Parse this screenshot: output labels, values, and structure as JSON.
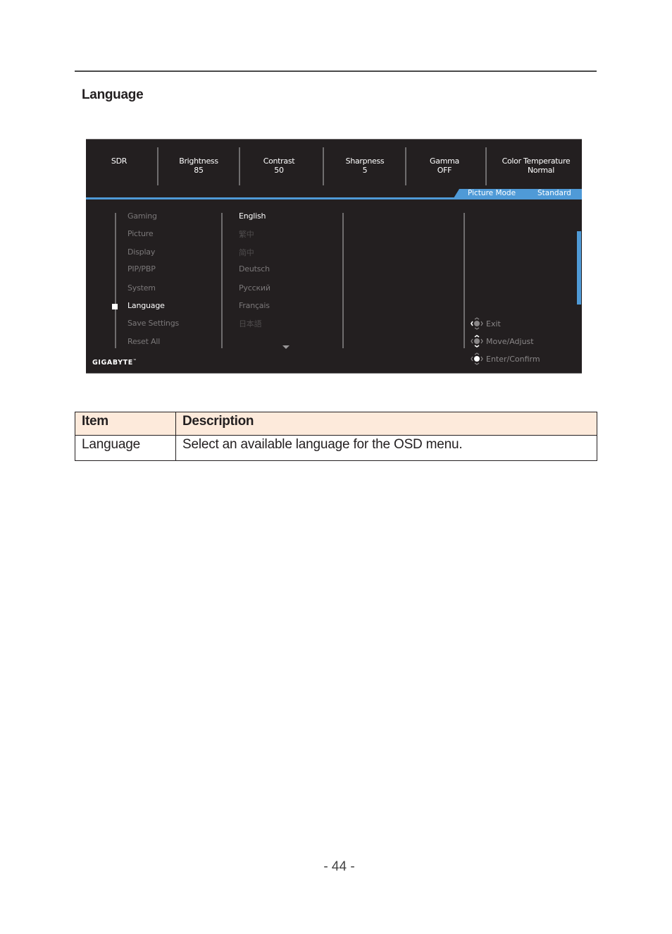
{
  "section": {
    "title": "Language"
  },
  "osd": {
    "stats": [
      {
        "label": "SDR",
        "value": ""
      },
      {
        "label": "Brightness",
        "value": "85"
      },
      {
        "label": "Contrast",
        "value": "50"
      },
      {
        "label": "Sharpness",
        "value": "5"
      },
      {
        "label": "Gamma",
        "value": "OFF"
      },
      {
        "label": "Color Temperature",
        "value": "Normal"
      }
    ],
    "picture_mode": {
      "label": "Picture Mode",
      "value": "Standard"
    },
    "menu": [
      {
        "label": "Gaming",
        "active": false
      },
      {
        "label": "Picture",
        "active": false
      },
      {
        "label": "Display",
        "active": false
      },
      {
        "label": "PIP/PBP",
        "active": false
      },
      {
        "label": "System",
        "active": false
      },
      {
        "label": "Language",
        "active": true
      },
      {
        "label": "Save Settings",
        "active": false
      },
      {
        "label": "Reset All",
        "active": false
      }
    ],
    "languages": [
      {
        "label": "English",
        "state": "selected"
      },
      {
        "label": "繁中",
        "state": "dim"
      },
      {
        "label": "简中",
        "state": "dim"
      },
      {
        "label": "Deutsch",
        "state": "normal"
      },
      {
        "label": "Русский",
        "state": "normal"
      },
      {
        "label": "Français",
        "state": "normal"
      },
      {
        "label": "日本語",
        "state": "dim"
      }
    ],
    "hints": [
      {
        "icon": "joystick-left-icon",
        "label": "Exit"
      },
      {
        "icon": "joystick-updown-icon",
        "label": "Move/Adjust"
      },
      {
        "icon": "joystick-press-icon",
        "label": "Enter/Confirm"
      }
    ],
    "brand": "GIGABYTE",
    "brand_mark": "™",
    "colors": {
      "accent": "#4f9ad7",
      "background": "#231f20"
    }
  },
  "table": {
    "headers": [
      "Item",
      "Description"
    ],
    "rows": [
      [
        "Language",
        "Select an available language for the OSD menu."
      ]
    ],
    "header_bg": "#fdeadb"
  },
  "page": {
    "number": "- 44 -"
  }
}
